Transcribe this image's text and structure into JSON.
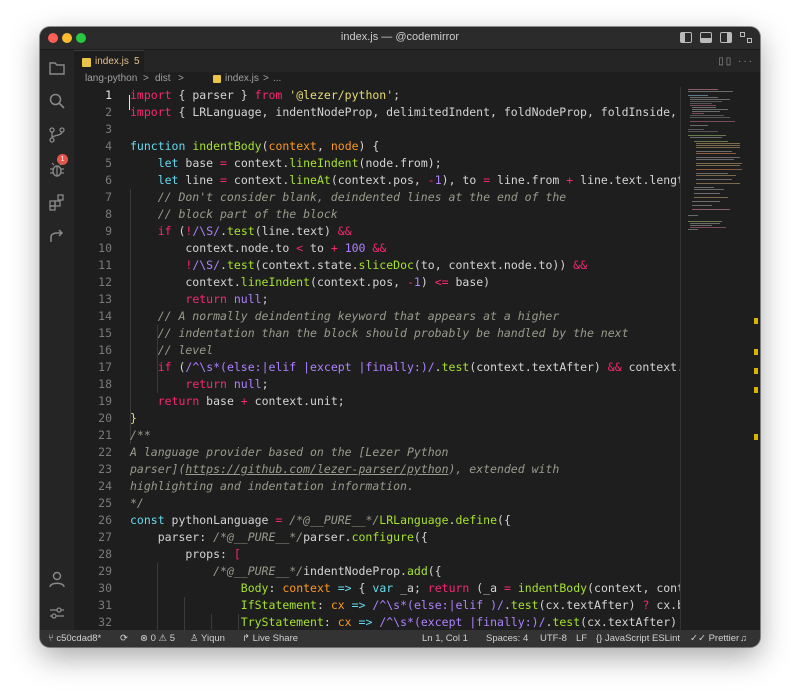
{
  "window": {
    "title": "index.js — @codemirror"
  },
  "activity_bar": {
    "items": [
      {
        "name": "explorer-icon"
      },
      {
        "name": "search-icon"
      },
      {
        "name": "source-control-icon",
        "badge": "1"
      },
      {
        "name": "debug-icon"
      },
      {
        "name": "extensions-icon"
      },
      {
        "name": "remote-icon"
      },
      {
        "name": "account-icon"
      },
      {
        "name": "settings-icon"
      }
    ]
  },
  "tab": {
    "label": "index.js",
    "problems": "5"
  },
  "breadcrumb": {
    "part1": "lang-python",
    "sep1": ">",
    "part2": "dist",
    "sep2": ">",
    "part3": "index.js",
    "sep3": ">",
    "part4": "..."
  },
  "editor": {
    "line_numbers": [
      "1",
      "2",
      "3",
      "4",
      "5",
      "6",
      "7",
      "8",
      "9",
      "10",
      "11",
      "12",
      "13",
      "14",
      "15",
      "16",
      "17",
      "18",
      "19",
      "20",
      "21",
      "22",
      "23",
      "24",
      "25",
      "26",
      "27",
      "28",
      "29",
      "30",
      "31",
      "32"
    ],
    "current_line": "1"
  },
  "statusbar": {
    "branch": "c50cdad8*",
    "errors": "0",
    "warnings": "5",
    "user": "Yiqun",
    "live_share": "Live Share",
    "position": "Ln 1, Col 1",
    "spaces": "Spaces: 4",
    "encoding": "UTF-8",
    "eol": "LF",
    "language": "JavaScript",
    "linter": "ESLint",
    "formatter": "Prettier"
  },
  "colors": {
    "keyword": "#f92672",
    "function": "#a6e22e",
    "string": "#e6db74",
    "number": "#ae81ff",
    "comment": "#9a9a8c"
  }
}
